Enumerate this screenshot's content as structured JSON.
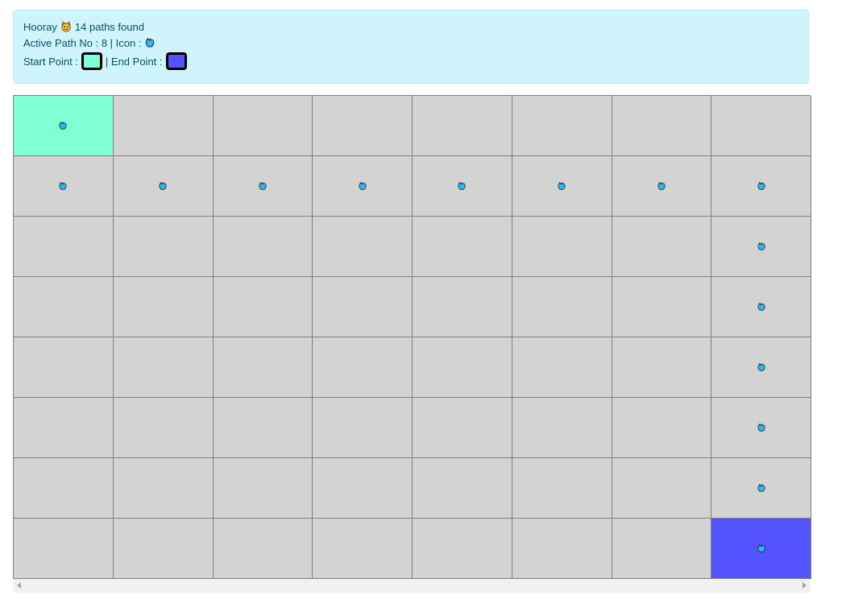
{
  "alert": {
    "hooray_text": "Hooray",
    "found_text": "14 paths found",
    "active_path_text": "Active Path No : 8 | Icon :",
    "start_label": "Start Point :",
    "end_label": "| End Point :",
    "celebration_icon": "cat-face-emoji",
    "path_icon": "blue-apple-icon"
  },
  "grid": {
    "rows": 8,
    "cols": 8,
    "start": [
      0,
      0
    ],
    "end": [
      7,
      7
    ],
    "path": [
      [
        0,
        0
      ],
      [
        1,
        0
      ],
      [
        1,
        1
      ],
      [
        1,
        2
      ],
      [
        1,
        3
      ],
      [
        1,
        4
      ],
      [
        1,
        5
      ],
      [
        1,
        6
      ],
      [
        1,
        7
      ],
      [
        2,
        7
      ],
      [
        3,
        7
      ],
      [
        4,
        7
      ],
      [
        5,
        7
      ],
      [
        6,
        7
      ],
      [
        7,
        7
      ]
    ]
  },
  "colors": {
    "start": "#7fffd4",
    "end": "#5353ff",
    "cell": "#d3d3d3",
    "alert_bg": "#cff4fc",
    "alert_text": "#055160"
  }
}
